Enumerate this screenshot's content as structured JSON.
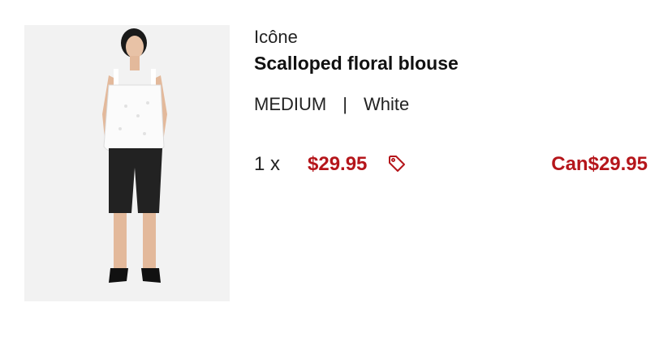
{
  "product": {
    "image_alt": "Woman wearing white scalloped floral blouse and black shorts",
    "brand": "Icône",
    "title": "Scalloped floral blouse",
    "size": "MEDIUM",
    "separator": "|",
    "color": "White",
    "quantity_text": "1 x",
    "unit_price": "$29.95",
    "total_price": "Can$29.95"
  },
  "icons": {
    "price_tag": "tag-icon"
  },
  "colors": {
    "price_red": "#b5161b",
    "text": "#1f1f1f",
    "image_bg": "#f2f2f2"
  }
}
